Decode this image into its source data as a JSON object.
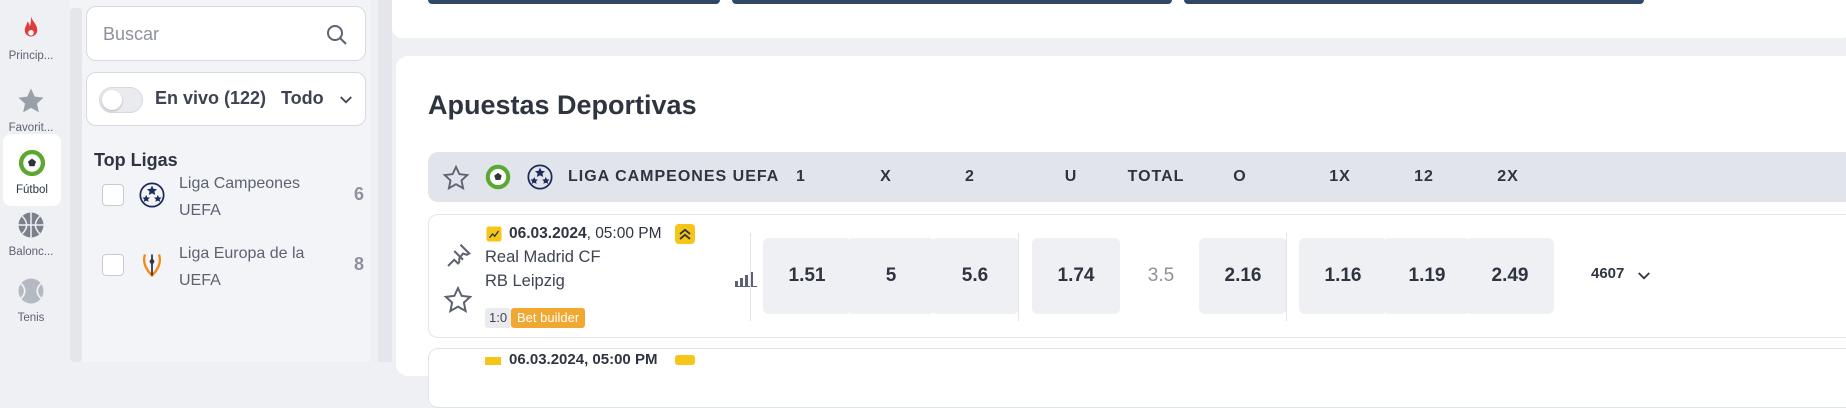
{
  "rail": [
    {
      "label": "Princip...",
      "icon": "flame-icon"
    },
    {
      "label": "Favorit...",
      "icon": "star-icon"
    },
    {
      "label": "Fútbol",
      "icon": "soccer-ball-icon"
    },
    {
      "label": "Balonc...",
      "icon": "basketball-icon"
    },
    {
      "label": "Tenis",
      "icon": "tennis-ball-icon"
    }
  ],
  "search": {
    "placeholder": "Buscar"
  },
  "live": {
    "label": "En vivo (122)",
    "filter": "Todo"
  },
  "top_leagues": {
    "title": "Top Ligas",
    "items": [
      {
        "name": "Liga Campeones UEFA",
        "count": "6",
        "icon": "champions-league-icon"
      },
      {
        "name": "Liga Europa de la UEFA",
        "count": "8",
        "icon": "europa-league-icon"
      }
    ]
  },
  "main": {
    "title": "Apuestas Deportivas",
    "league_header": {
      "name": "LIGA CAMPEONES UEFA",
      "columns": [
        "1",
        "X",
        "2",
        "U",
        "TOTAL",
        "O",
        "1X",
        "12",
        "2X"
      ]
    },
    "match": {
      "date": "06.03.2024",
      "time": ", 05:00 PM",
      "home": "Real Madrid CF",
      "away": "RB Leipzig",
      "score": "1:0",
      "tag": "Bet builder",
      "odds": [
        "1.51",
        "5",
        "5.6",
        "1.74",
        "3.5",
        "2.16",
        "1.16",
        "1.19",
        "2.49"
      ],
      "more_markets": "4607"
    },
    "next_match": {
      "date": "06.03.2024, 05:00 PM"
    }
  },
  "colors": {
    "accent": "#f5c518",
    "tag_orange": "#f0a830",
    "banner": "#2f4866",
    "flame": "#e03a3a",
    "ball_green": "#5aa832"
  }
}
